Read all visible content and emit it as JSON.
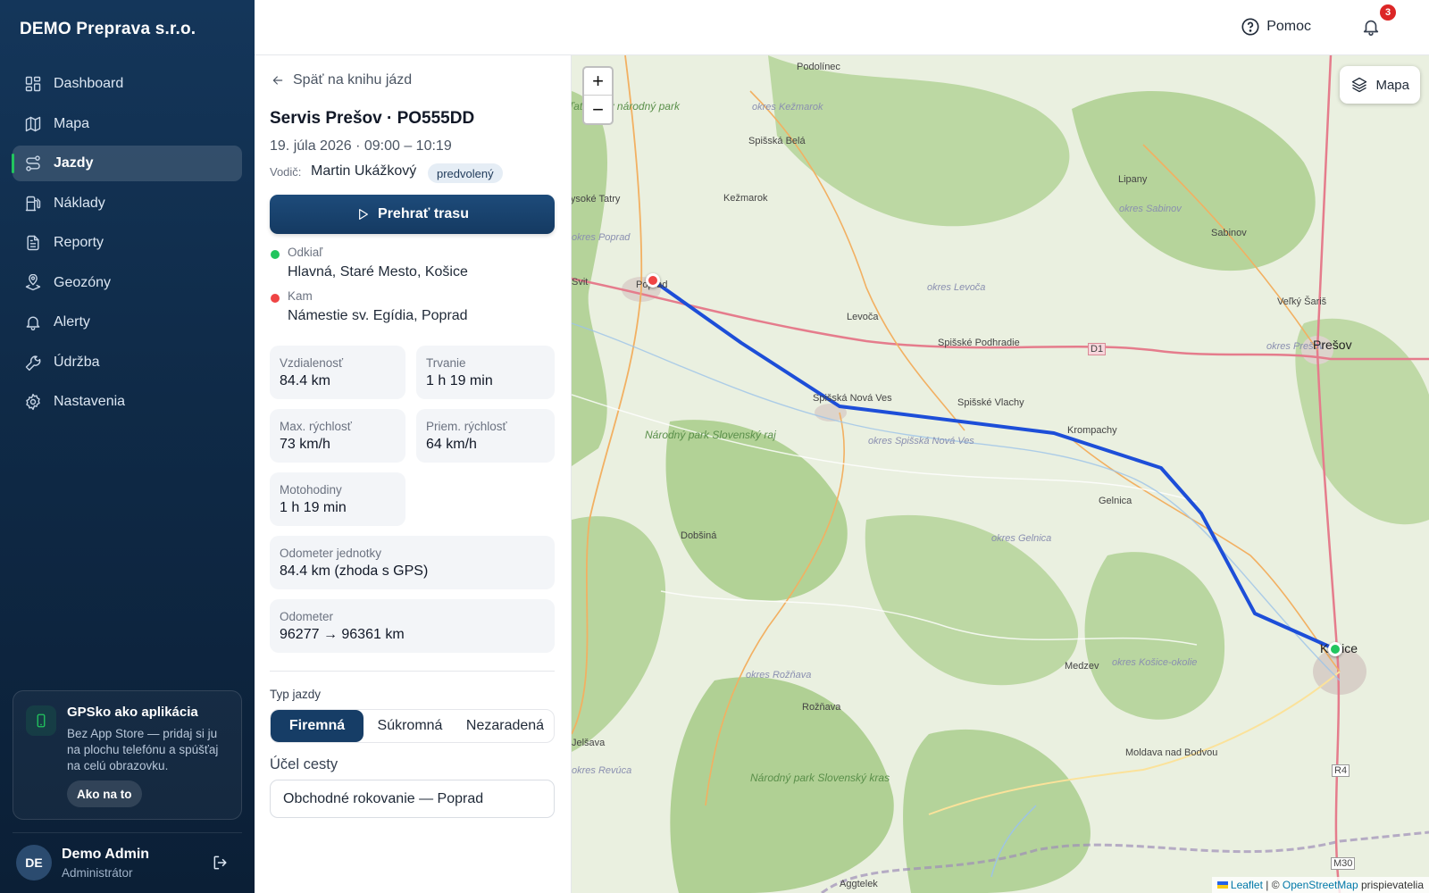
{
  "app": {
    "company": "DEMO Preprava s.r.o."
  },
  "sidebar": {
    "items": [
      {
        "label": "Dashboard",
        "icon": "dashboard-icon"
      },
      {
        "label": "Mapa",
        "icon": "map-icon"
      },
      {
        "label": "Jazdy",
        "icon": "route-icon",
        "active": true
      },
      {
        "label": "Náklady",
        "icon": "fuel-icon"
      },
      {
        "label": "Reporty",
        "icon": "report-icon"
      },
      {
        "label": "Geozóny",
        "icon": "geofence-icon"
      },
      {
        "label": "Alerty",
        "icon": "bell-icon"
      },
      {
        "label": "Údržba",
        "icon": "wrench-icon"
      },
      {
        "label": "Nastavenia",
        "icon": "gear-icon"
      }
    ],
    "promo": {
      "title": "GPSko ako aplikácia",
      "text": "Bez App Store — pridaj si ju na plochu telefónu a spúšťaj na celú obrazovku.",
      "button": "Ako na to"
    },
    "user": {
      "initials": "DE",
      "name": "Demo Admin",
      "role": "Administrátor"
    }
  },
  "topbar": {
    "help": "Pomoc",
    "notifications": "3"
  },
  "trip": {
    "back": "Späť na knihu jázd",
    "title": "Servis Prešov · PO555DD",
    "time": "19. júla 2026 · 09:00 – 10:19",
    "driver_label": "Vodič:",
    "driver": "Martin Ukážkový",
    "driver_tag": "predvolený",
    "play": "Prehrať trasu",
    "from_label": "Odkiaľ",
    "from": "Hlavná, Staré Mesto, Košice",
    "to_label": "Kam",
    "to": "Námestie sv. Egídia, Poprad",
    "stats": {
      "distance_label": "Vzdialenosť",
      "distance": "84.4 km",
      "duration_label": "Trvanie",
      "duration": "1 h 19 min",
      "maxspeed_label": "Max. rýchlosť",
      "maxspeed": "73 km/h",
      "avgspeed_label": "Priem. rýchlosť",
      "avgspeed": "64 km/h",
      "motohours_label": "Motohodiny",
      "motohours": "1 h 19 min",
      "unitodo_label": "Odometer jednotky",
      "unitodo": "84.4 km (zhoda s GPS)",
      "odo_label": "Odometer",
      "odo": "96277 → 96361 km"
    },
    "type_label": "Typ jazdy",
    "types": [
      "Firemná",
      "Súkromná",
      "Nezaradená"
    ],
    "purpose_label": "Účel cesty",
    "purpose": "Obchodné rokovanie — Poprad"
  },
  "map": {
    "layer_button": "Mapa",
    "zoom_in": "+",
    "zoom_out": "−",
    "attribution_leaflet": "Leaflet",
    "attribution_sep": " | © ",
    "attribution_osm": "OpenStreetMap",
    "attribution_tail": " prispievatelia",
    "places": [
      "Podolínec",
      "okres Kežmarok",
      "Tatranský národný park",
      "Spišská Belá",
      "Kežmarok",
      "Vysoké Tatry",
      "okres Poprad",
      "Svit",
      "Poprad",
      "Lipany",
      "okres Sabinov",
      "Sabinov",
      "okres Levoča",
      "Levoča",
      "Spišské Podhradie",
      "D1",
      "Veľký Šariš",
      "okres Prešov",
      "Prešov",
      "Spišská Nová Ves",
      "Spišské Vlachy",
      "Krompachy",
      "Národný park Slovenský raj",
      "okres Spišská Nová Ves",
      "Gelnica",
      "Dobšiná",
      "okres Gelnica",
      "Medzev",
      "okres Košice-okolie",
      "Košice",
      "okres Rožňava",
      "Rožňava",
      "Moldava nad Bodvou",
      "Národný park Slovenský kras",
      "Jelšava",
      "okres Revúca",
      "R4",
      "M30",
      "Aggtelek"
    ]
  },
  "colors": {
    "sidebar": "#0f2a47",
    "accent": "#22c55e",
    "primary": "#163d66",
    "route": "#1d4ed8",
    "start_marker": "#22c55e",
    "end_marker": "#ef4444"
  }
}
